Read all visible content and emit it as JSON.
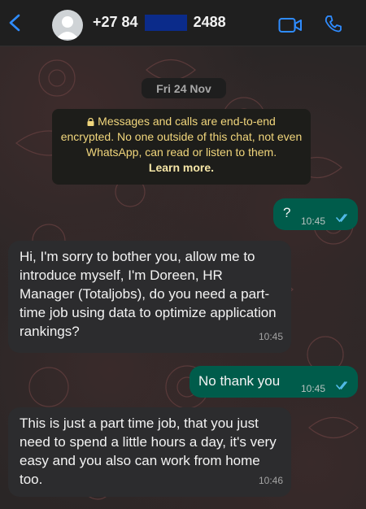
{
  "header": {
    "contact_prefix": "+27 84",
    "contact_suffix": "2488",
    "accent_color": "#2f8cff"
  },
  "chat": {
    "date": "Fri 24 Nov",
    "encryption_notice": "Messages and calls are end-to-end encrypted. No one outside of this chat, not even WhatsApp, can read or listen to them.",
    "encryption_link": "Learn more.",
    "messages": [
      {
        "direction": "outgoing",
        "text": "?",
        "time": "10:45",
        "status": "read"
      },
      {
        "direction": "incoming",
        "text": "Hi, I'm sorry to bother you, allow me to introduce myself, I'm Doreen, HR Manager (Totaljobs), do you need a part-time job using data to optimize application rankings?",
        "time": "10:45"
      },
      {
        "direction": "outgoing",
        "text": "No thank you",
        "time": "10:45",
        "status": "read"
      },
      {
        "direction": "incoming",
        "text": "This is just a part time job, that you just need to spend a little hours a day, it's very easy and you also can work from home too.",
        "time": "10:46"
      }
    ]
  },
  "icons": {
    "back": "chevron-left-icon",
    "avatar": "default-avatar-icon",
    "video": "video-camera-icon",
    "call": "phone-icon",
    "lock": "lock-icon",
    "ticks": "double-check-icon"
  }
}
